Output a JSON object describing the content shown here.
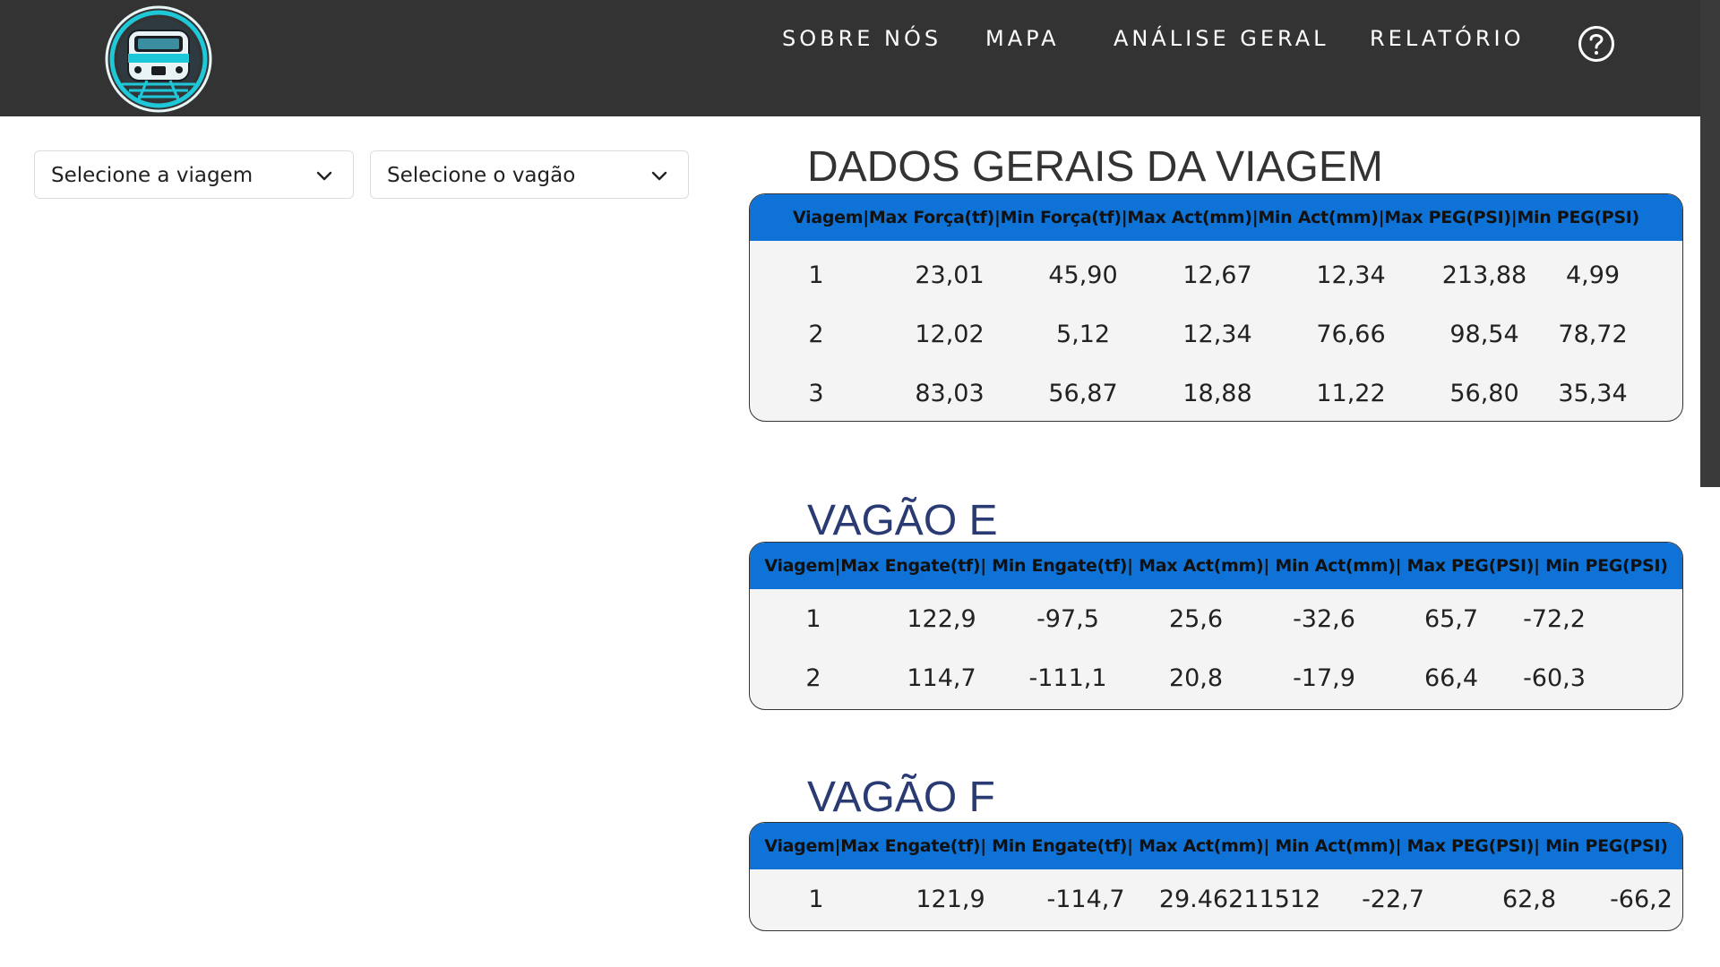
{
  "nav": {
    "items": [
      "SOBRE NÓS",
      "MAPA",
      "ANÁLISE GERAL",
      "RELATÓRIO"
    ],
    "help_icon": "question-circle-icon",
    "logo_icon": "train-logo-icon"
  },
  "filters": {
    "viagem_placeholder": "Selecione a viagem",
    "vagao_placeholder": "Selecione o vagão"
  },
  "colors": {
    "nav_bg": "#333333",
    "header_blue": "#0f72d6",
    "title_dark": "#333333",
    "title_blue": "#2a3a72"
  },
  "dados_gerais": {
    "title": "DADOS GERAIS DA VIAGEM",
    "header": "Viagem|Max Força(tf)|Min Força(tf)|Max Act(mm)|Min Act(mm)|Max PEG(PSI)|Min PEG(PSI)",
    "rows": [
      [
        "1",
        "23,01",
        "45,90",
        "12,67",
        "12,34",
        "213,88",
        "4,99"
      ],
      [
        "2",
        "12,02",
        "5,12",
        "12,34",
        "76,66",
        "98,54",
        "78,72"
      ],
      [
        "3",
        "83,03",
        "56,87",
        "18,88",
        "11,22",
        "56,80",
        "35,34"
      ]
    ]
  },
  "vagao_e": {
    "title": "VAGÃO E",
    "header": "Viagem|Max Engate(tf)| Min Engate(tf)| Max Act(mm)| Min Act(mm)| Max PEG(PSI)| Min PEG(PSI)",
    "rows": [
      [
        "1",
        "122,9",
        "-97,5",
        "25,6",
        "-32,6",
        "65,7",
        "-72,2"
      ],
      [
        "2",
        "114,7",
        "-111,1",
        "20,8",
        "-17,9",
        "66,4",
        "-60,3"
      ]
    ]
  },
  "vagao_f": {
    "title": "VAGÃO F",
    "header": "Viagem|Max Engate(tf)| Min Engate(tf)| Max Act(mm)| Min Act(mm)| Max PEG(PSI)| Min PEG(PSI)",
    "rows": [
      [
        "1",
        "121,9",
        "-114,7",
        "29.46211512",
        "-22,7",
        "62,8",
        "-66,2"
      ]
    ]
  }
}
